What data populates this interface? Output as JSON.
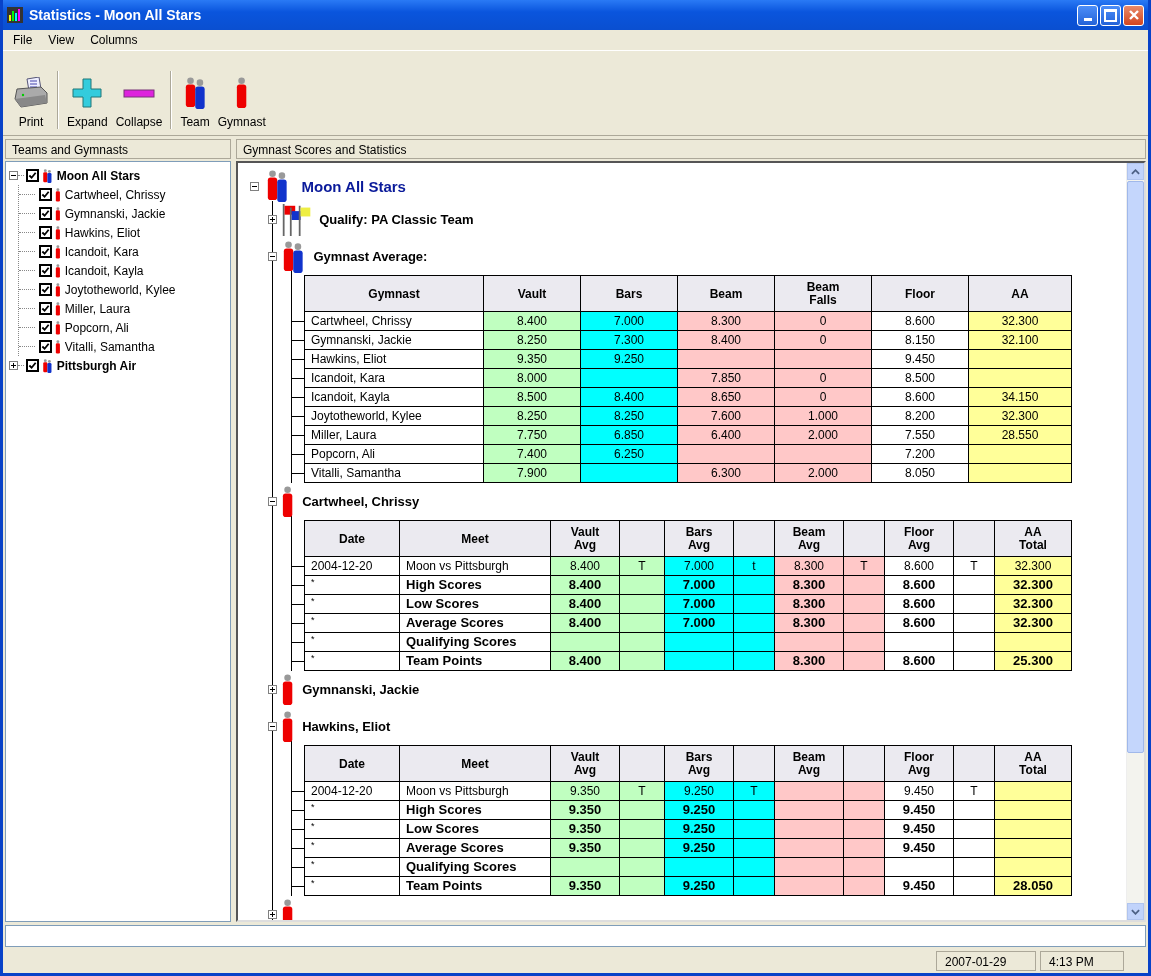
{
  "window": {
    "title": "Statistics - Moon All Stars"
  },
  "menu": [
    "File",
    "View",
    "Columns"
  ],
  "toolbar": [
    {
      "label": "Print",
      "kind": "print"
    },
    {
      "label": "Expand",
      "kind": "expand"
    },
    {
      "label": "Collapse",
      "kind": "collapse"
    },
    {
      "label": "Team",
      "kind": "team"
    },
    {
      "label": "Gymnast",
      "kind": "gymnast"
    }
  ],
  "left_panel": {
    "header": "Teams and Gymnasts",
    "tree": [
      {
        "label": "Moon All Stars",
        "expanded": true,
        "checked": true,
        "children": [
          {
            "label": "Cartwheel, Chrissy",
            "checked": true
          },
          {
            "label": "Gymnanski, Jackie",
            "checked": true
          },
          {
            "label": "Hawkins, Eliot",
            "checked": true
          },
          {
            "label": "Icandoit, Kara",
            "checked": true
          },
          {
            "label": "Icandoit, Kayla",
            "checked": true
          },
          {
            "label": "Joytotheworld, Kylee",
            "checked": true
          },
          {
            "label": "Miller, Laura",
            "checked": true
          },
          {
            "label": "Popcorn, Ali",
            "checked": true
          },
          {
            "label": "Vitalli, Samantha",
            "checked": true
          }
        ]
      },
      {
        "label": "Pittsburgh Air",
        "expanded": false,
        "checked": true
      }
    ]
  },
  "right_panel": {
    "header": "Gymnast Scores and Statistics",
    "team_name": "Moon All Stars",
    "expanded": true,
    "sections": [
      {
        "kind": "qualify",
        "label": "Qualify: PA Classic Team",
        "expanded": false
      },
      {
        "kind": "team",
        "label": "Gymnast Average:",
        "expanded": true,
        "table": {
          "columns": [
            {
              "label": "Gymnast"
            },
            {
              "label": "Vault",
              "color": "#c0ffc0"
            },
            {
              "label": "Bars",
              "color": "#00ffff"
            },
            {
              "label": "Beam",
              "color": "#ffc8c8"
            },
            {
              "label": "Beam Falls",
              "color": "#ffc8c8"
            },
            {
              "label": "Floor",
              "color": "#ffffff"
            },
            {
              "label": "AA",
              "color": "#ffff99"
            }
          ],
          "rows": [
            {
              "bold": false,
              "cells": [
                "Cartwheel, Chrissy",
                "8.400",
                "7.000",
                "8.300",
                "0",
                "8.600",
                "32.300"
              ]
            },
            {
              "bold": false,
              "cells": [
                "Gymnanski, Jackie",
                "8.250",
                "7.300",
                "8.400",
                "0",
                "8.150",
                "32.100"
              ]
            },
            {
              "bold": false,
              "cells": [
                "Hawkins, Eliot",
                "9.350",
                "9.250",
                null,
                null,
                "9.450",
                null
              ]
            },
            {
              "bold": false,
              "cells": [
                "Icandoit, Kara",
                "8.000",
                null,
                "7.850",
                "0",
                "8.500",
                null
              ]
            },
            {
              "bold": false,
              "cells": [
                "Icandoit, Kayla",
                "8.500",
                "8.400",
                "8.650",
                "0",
                "8.600",
                "34.150"
              ]
            },
            {
              "bold": false,
              "cells": [
                "Joytotheworld, Kylee",
                "8.250",
                "8.250",
                "7.600",
                "1.000",
                "8.200",
                "32.300"
              ]
            },
            {
              "bold": false,
              "cells": [
                "Miller, Laura",
                "7.750",
                "6.850",
                "6.400",
                "2.000",
                "7.550",
                "28.550"
              ]
            },
            {
              "bold": false,
              "cells": [
                "Popcorn, Ali",
                "7.400",
                "6.250",
                null,
                null,
                "7.200",
                null
              ]
            },
            {
              "bold": false,
              "cells": [
                "Vitalli, Samantha",
                "7.900",
                null,
                "6.300",
                "2.000",
                "8.050",
                null
              ]
            }
          ]
        }
      },
      {
        "kind": "gymnast",
        "label": "Cartwheel, Chrissy",
        "expanded": true,
        "table": {
          "columns": [
            {
              "label": "Date"
            },
            {
              "label": "Meet"
            },
            {
              "label": "Vault Avg",
              "color": "#c0ffc0"
            },
            {
              "color": "#c0ffc0"
            },
            {
              "label": "Bars Avg",
              "color": "#00ffff"
            },
            {
              "color": "#00ffff"
            },
            {
              "label": "Beam Avg",
              "color": "#ffc8c8"
            },
            {
              "color": "#ffc8c8"
            },
            {
              "label": "Floor Avg",
              "color": "#ffffff"
            },
            {
              "color": "#ffffff"
            },
            {
              "label": "AA Total",
              "color": "#ffff99"
            }
          ],
          "rows": [
            {
              "bold": false,
              "cells": [
                "2004-12-20",
                "Moon vs Pittsburgh",
                "8.400",
                "T",
                "7.000",
                "t",
                "8.300",
                "T",
                "8.600",
                "T",
                "32.300"
              ]
            },
            {
              "bold": true,
              "cells": [
                "*",
                "High Scores",
                "8.400",
                null,
                "7.000",
                null,
                "8.300",
                null,
                "8.600",
                null,
                "32.300"
              ]
            },
            {
              "bold": true,
              "cells": [
                "*",
                "Low Scores",
                "8.400",
                null,
                "7.000",
                null,
                "8.300",
                null,
                "8.600",
                null,
                "32.300"
              ]
            },
            {
              "bold": true,
              "cells": [
                "*",
                "Average Scores",
                "8.400",
                null,
                "7.000",
                null,
                "8.300",
                null,
                "8.600",
                null,
                "32.300"
              ]
            },
            {
              "bold": true,
              "cells": [
                "*",
                "Qualifying Scores",
                null,
                null,
                null,
                null,
                null,
                null,
                null,
                null,
                null
              ]
            },
            {
              "bold": true,
              "cells": [
                "*",
                "Team Points",
                "8.400",
                null,
                null,
                null,
                "8.300",
                null,
                "8.600",
                null,
                "25.300"
              ]
            }
          ]
        }
      },
      {
        "kind": "gymnast",
        "label": "Gymnanski, Jackie",
        "expanded": false
      },
      {
        "kind": "gymnast",
        "label": "Hawkins, Eliot",
        "expanded": true,
        "table": {
          "columns": [
            {
              "label": "Date"
            },
            {
              "label": "Meet"
            },
            {
              "label": "Vault Avg",
              "color": "#c0ffc0"
            },
            {
              "color": "#c0ffc0"
            },
            {
              "label": "Bars Avg",
              "color": "#00ffff"
            },
            {
              "color": "#00ffff"
            },
            {
              "label": "Beam Avg",
              "color": "#ffc8c8"
            },
            {
              "color": "#ffc8c8"
            },
            {
              "label": "Floor Avg",
              "color": "#ffffff"
            },
            {
              "color": "#ffffff"
            },
            {
              "label": "AA Total",
              "color": "#ffff99"
            }
          ],
          "rows": [
            {
              "bold": false,
              "cells": [
                "2004-12-20",
                "Moon vs Pittsburgh",
                "9.350",
                "T",
                "9.250",
                "T",
                null,
                null,
                "9.450",
                "T",
                null
              ]
            },
            {
              "bold": true,
              "cells": [
                "*",
                "High Scores",
                "9.350",
                null,
                "9.250",
                null,
                null,
                null,
                "9.450",
                null,
                null
              ]
            },
            {
              "bold": true,
              "cells": [
                "*",
                "Low Scores",
                "9.350",
                null,
                "9.250",
                null,
                null,
                null,
                "9.450",
                null,
                null
              ]
            },
            {
              "bold": true,
              "cells": [
                "*",
                "Average Scores",
                "9.350",
                null,
                "9.250",
                null,
                null,
                null,
                "9.450",
                null,
                null
              ]
            },
            {
              "bold": true,
              "cells": [
                "*",
                "Qualifying Scores",
                null,
                null,
                null,
                null,
                null,
                null,
                null,
                null,
                null
              ]
            },
            {
              "bold": true,
              "cells": [
                "*",
                "Team Points",
                "9.350",
                null,
                "9.250",
                null,
                null,
                null,
                "9.450",
                null,
                "28.050"
              ]
            }
          ]
        }
      },
      {
        "kind": "gymnast",
        "expanded": false
      }
    ]
  },
  "status_bar": {
    "date": "2007-01-29",
    "time": "4:13 PM"
  }
}
